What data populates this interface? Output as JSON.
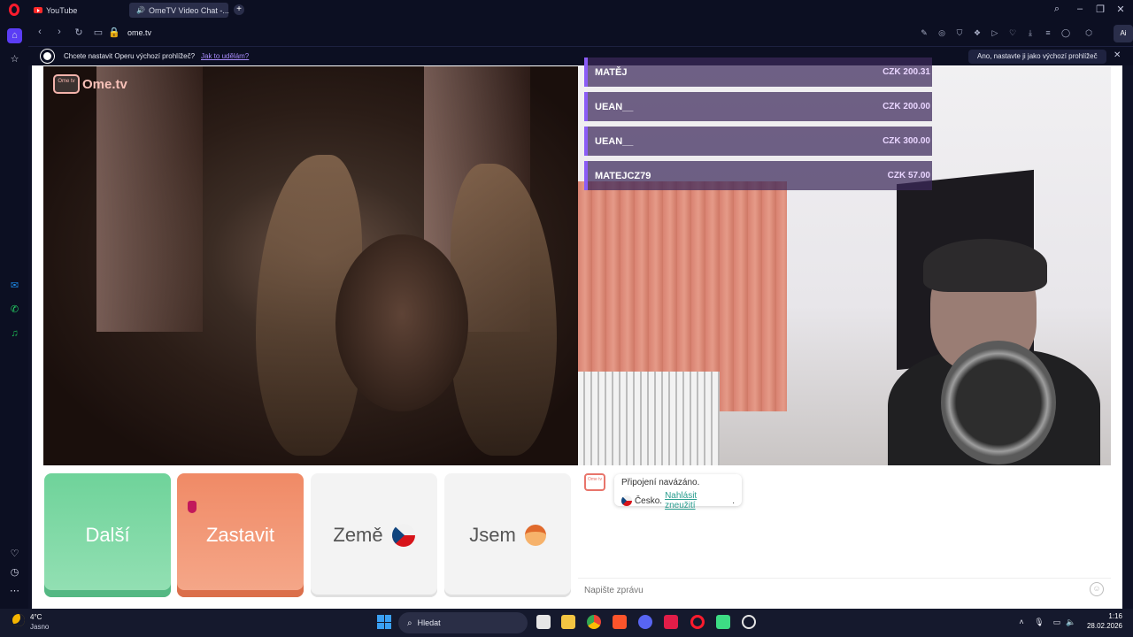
{
  "browser": {
    "tabs": [
      {
        "label": "YouTube"
      },
      {
        "label": "OmeTV Video Chat -..."
      }
    ],
    "url": "ome.tv",
    "infobar": {
      "question": "Chcete nastavit Operu výchozí prohlížeč?",
      "link": "Jak to udělám?",
      "button": "Ano, nastavte ji jako výchozí prohlížeč"
    },
    "ai_label": "Ai"
  },
  "ometv": {
    "logo_text": "Ome.tv",
    "logo_tv": "Ome tv",
    "donations": [
      {
        "name": "MATĚJ",
        "amount": "CZK 200.31"
      },
      {
        "name": "UEAN__",
        "amount": "CZK 200.00"
      },
      {
        "name": "UEAN__",
        "amount": "CZK 300.00"
      },
      {
        "name": "MATEJCZ79",
        "amount": "CZK 57.00"
      }
    ],
    "buttons": {
      "next": "Další",
      "stop": "Zastavit",
      "country": "Země",
      "gender": "Jsem"
    },
    "chat": {
      "status": "Připojení navázáno.",
      "country": "Česko.",
      "report_link": "Nahlásit zneužití",
      "report_suffix": ".",
      "placeholder": "Napište zprávu"
    }
  },
  "taskbar": {
    "weather_temp": "4°C",
    "weather_desc": "Jasno",
    "search_label": "Hledat",
    "time": "1:16",
    "date": "28.02.2026"
  },
  "colors": {
    "next_green": "#6fd39a",
    "stop_orange": "#f08a66",
    "donation_accent": "#8b5cf6",
    "opera_red": "#ff1b2d"
  }
}
